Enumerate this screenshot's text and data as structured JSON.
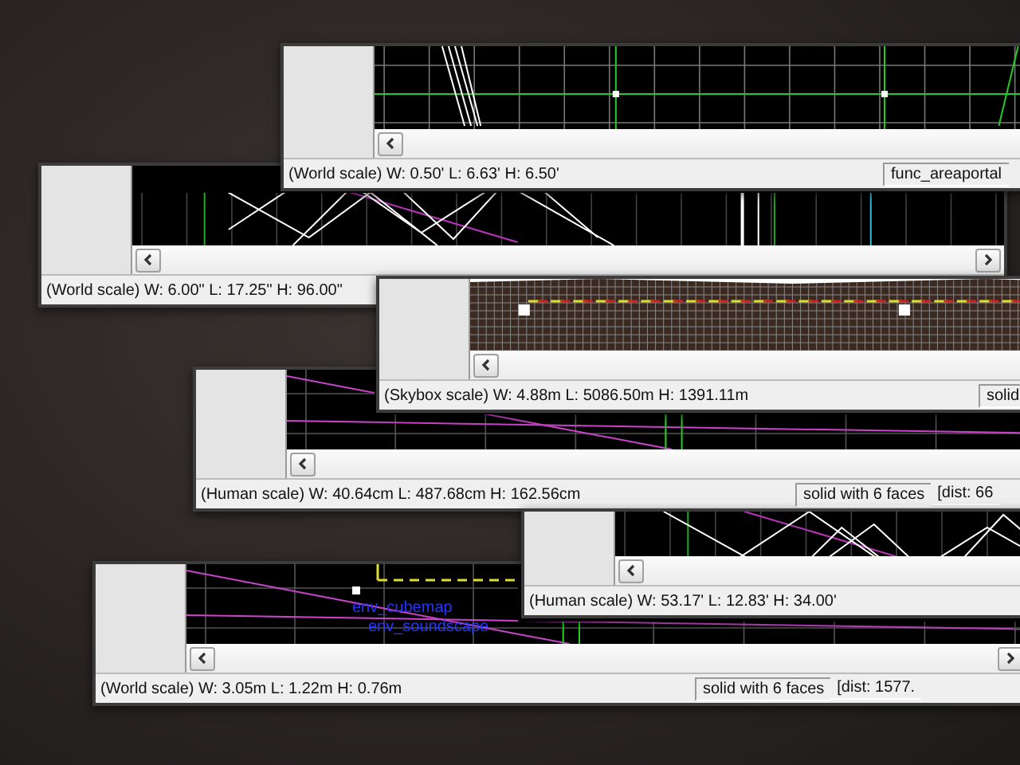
{
  "windows": [
    {
      "kind": "grid",
      "status": "(World scale) W: 0.50' L: 6.63' H: 6.50'",
      "fields": [
        "func_areaportal"
      ]
    },
    {
      "kind": "wireframe",
      "status": "(World scale) W: 6.00\" L: 17.25\" H: 96.00\""
    },
    {
      "kind": "skybox",
      "status": "(Skybox scale) W: 4.88m L: 5086.50m H: 1391.11m",
      "fields": [
        "solid"
      ]
    },
    {
      "kind": "lines",
      "status": "(Human scale) W: 40.64cm L: 487.68cm H: 162.56cm",
      "fields": [
        "solid with 6 faces",
        "[dist: 66"
      ]
    },
    {
      "kind": "wireframe",
      "status": "(Human scale) W: 53.17' L: 12.83' H: 34.00'"
    },
    {
      "kind": "lines",
      "status": "(World scale) W: 3.05m L: 1.22m H: 0.76m",
      "fields": [
        "solid with 6 faces",
        "[dist: 1577."
      ],
      "labels": [
        "env_cubemap",
        "env_soundscape"
      ]
    }
  ]
}
